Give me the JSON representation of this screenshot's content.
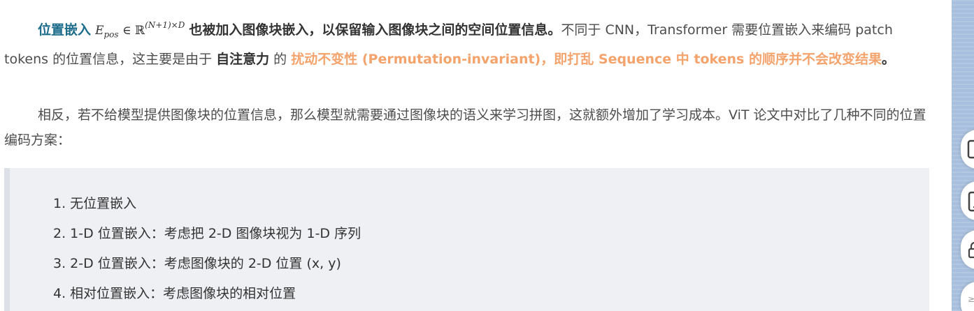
{
  "paragraph1": {
    "term": "位置嵌入",
    "math_E": "E",
    "math_sub": "pos",
    "math_in": "∈",
    "math_R": "ℝ",
    "math_sup": "(N+1)×D",
    "bold_rest": "也被加入图像块嵌入，以保留输入图像块之间的空间位置信息。",
    "text1": "不同于 CNN，Transformer 需要位置嵌入来编码 patch tokens 的位置信息，这主要是由于 ",
    "bold_attention": "自注意力",
    "text2": " 的 ",
    "orange1": "扰动不变性 (Permutation-invariant)",
    "comma": "，",
    "orange2": "即打乱 Sequence 中 tokens 的顺序并不会改变结果",
    "end": "。"
  },
  "paragraph2": {
    "text": "相反，若不给模型提供图像块的位置信息，那么模型就需要通过图像块的语义来学习拼图，这就额外增加了学习成本。ViT 论文中对比了几种不同的位置编码方案："
  },
  "list": [
    "1. 无位置嵌入",
    "2. 1-D 位置嵌入：考虑把 2-D 图像块视为 1-D 序列",
    "3. 2-D 位置嵌入：考虑图像块的 2-D 位置 (x, y)",
    "4. 相对位置嵌入：考虑图像块的相对位置"
  ],
  "sidebar": {
    "last_button_text": "≥"
  },
  "colors": {
    "term_blue": "#1d6c8c",
    "orange": "#f4a36c",
    "quote_bg": "#eef0f4",
    "sidebar": "#a8c0de"
  }
}
